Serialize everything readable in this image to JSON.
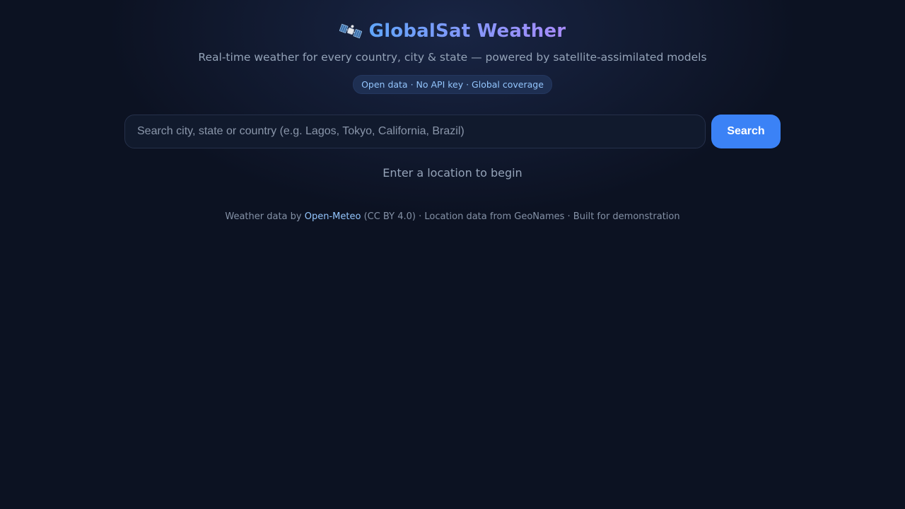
{
  "header": {
    "icon": "satellite-icon",
    "title": "GlobalSat Weather",
    "subtitle": "Real-time weather for every country, city & state — powered by satellite-assimilated models",
    "badge": "Open data · No API key · Global coverage"
  },
  "search": {
    "value": "",
    "placeholder": "Search city, state or country (e.g. Lagos, Tokyo, California, Brazil)",
    "button_label": "Search"
  },
  "status": {
    "message": "Enter a location to begin"
  },
  "footer": {
    "prefix": "Weather data by",
    "link_label": "Open-Meteo",
    "suffix": "(CC BY 4.0) · Location data from GeoNames · Built for demonstration"
  },
  "colors": {
    "background": "#0c1222",
    "accent": "#3b82f6",
    "title_gradient_start": "#60a5fa",
    "title_gradient_end": "#a78bfa",
    "badge_text": "#93c5fd"
  }
}
